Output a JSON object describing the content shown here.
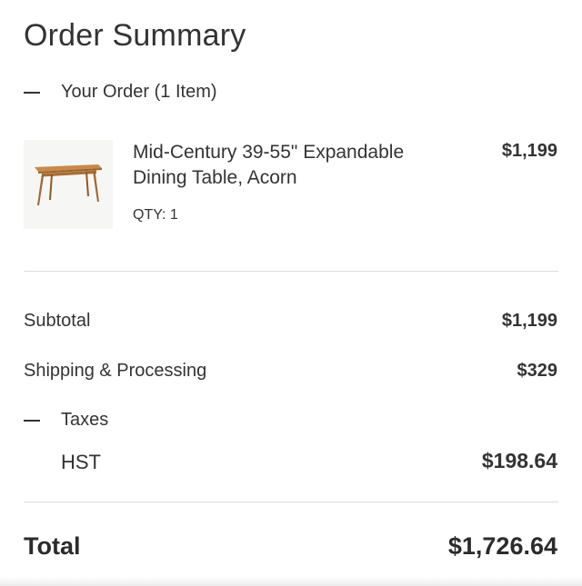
{
  "header": {
    "title": "Order Summary"
  },
  "order": {
    "toggle_label": "Your Order (1 Item)",
    "items": [
      {
        "name": "Mid-Century 39-55\" Expandable Dining Table, Acorn",
        "qty": "QTY: 1",
        "price": "$1,199",
        "thumbnail_icon": "dining-table-image"
      }
    ]
  },
  "summary": {
    "subtotal_label": "Subtotal",
    "subtotal_value": "$1,199",
    "shipping_label": "Shipping & Processing",
    "shipping_value": "$329",
    "taxes_label": "Taxes",
    "hst_label": "HST",
    "hst_value": "$198.64",
    "total_label": "Total",
    "total_value": "$1,726.64"
  },
  "colors": {
    "text": "#333333",
    "divider": "#dcdcdc",
    "wood": "#b8783a"
  }
}
